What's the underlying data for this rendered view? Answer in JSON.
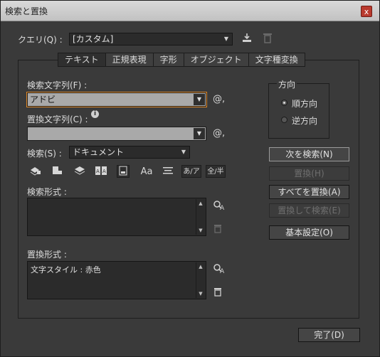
{
  "window": {
    "title": "検索と置換",
    "close_label": "x"
  },
  "query": {
    "label": "クエリ(Q) :",
    "value": "[カスタム]",
    "save_icon": "save-query-icon",
    "delete_icon": "trash-icon"
  },
  "tabs": [
    {
      "label": "テキスト",
      "active": true
    },
    {
      "label": "正規表現",
      "active": false
    },
    {
      "label": "字形",
      "active": false
    },
    {
      "label": "オブジェクト",
      "active": false
    },
    {
      "label": "文字種変換",
      "active": false
    }
  ],
  "find": {
    "label": "検索文字列(F) :",
    "value": "アドビ",
    "special_char": "@,"
  },
  "change": {
    "label": "置換文字列(C) :",
    "info_icon": "i",
    "value": "",
    "special_char": "@,"
  },
  "search": {
    "label": "検索(S) :",
    "value": "ドキュメント"
  },
  "options": {
    "icons": [
      "include-locked-layers-icon",
      "include-locked-stories-icon",
      "include-hidden-layers-icon",
      "include-master-pages-icon",
      "include-footnotes-icon",
      "case-sensitive-icon",
      "whole-word-icon",
      "kana-sensitive-icon",
      "width-sensitive-icon"
    ],
    "labels": {
      "case": "Aa",
      "kana": "あ/ア",
      "width": "全/半"
    }
  },
  "find_format": {
    "label": "検索形式 :",
    "value": ""
  },
  "change_format": {
    "label": "置換形式 :",
    "value": "文字スタイル : 赤色"
  },
  "direction": {
    "title": "方向",
    "forward": "順方向",
    "backward": "逆方向",
    "selected": "forward"
  },
  "buttons": {
    "find_next": "次を検索(N)",
    "change": "置換(H)",
    "change_all": "すべてを置換(A)",
    "change_find": "置換して検索(E)",
    "fewer_options": "基本設定(O)",
    "done": "完了(D)"
  },
  "colors": {
    "panel": "#3a3a3a",
    "field": "#a9a9a9",
    "focus": "#e08a2a",
    "close": "#b93a2e"
  }
}
